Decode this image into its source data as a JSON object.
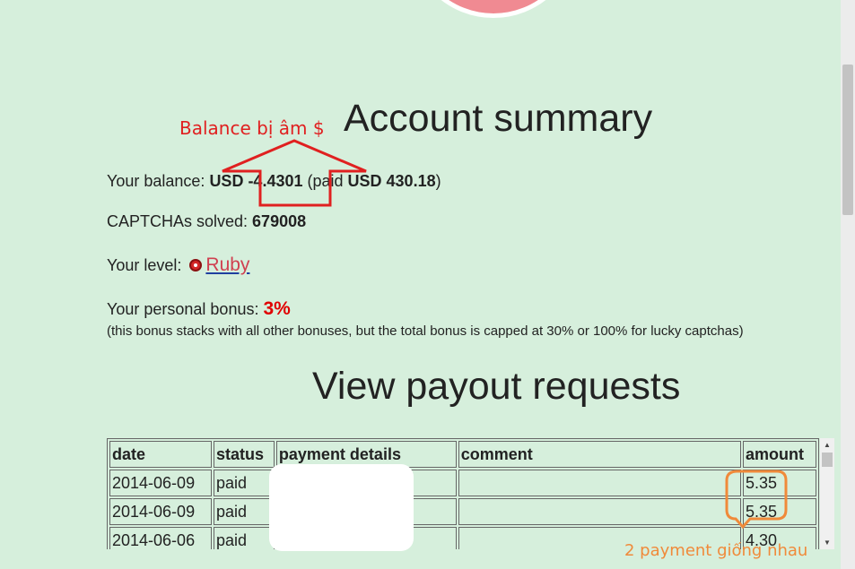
{
  "header": {
    "account_title": "Account summary",
    "payout_title": "View payout requests"
  },
  "summary": {
    "balance_label": "Your balance: ",
    "balance_value": "USD -4.4301",
    "paid_prefix": " (paid ",
    "paid_value": "USD 430.18",
    "paid_suffix": ")",
    "captchas_label": "CAPTCHAs solved: ",
    "captchas_value": "679008",
    "level_label": "Your level: ",
    "level_value": "Ruby",
    "bonus_label": "Your personal bonus: ",
    "bonus_value": "3%",
    "bonus_note": "(this bonus stacks with all other bonuses, but the total bonus is capped at 30% or 100% for lucky captchas)"
  },
  "payouts": {
    "columns": [
      "date",
      "status",
      "payment details",
      "comment",
      "amount"
    ],
    "rows": [
      {
        "date": "2014-06-09",
        "status": "paid",
        "details": "",
        "comment": "",
        "amount": "5.35"
      },
      {
        "date": "2014-06-09",
        "status": "paid",
        "details": "",
        "comment": "",
        "amount": "5.35"
      },
      {
        "date": "2014-06-06",
        "status": "paid",
        "details": "",
        "comment": "",
        "amount": "4.30"
      }
    ]
  },
  "annotations": {
    "balance_note": "Balance bị âm $",
    "payment_note": "2 payment giống nhau"
  },
  "icons": {
    "level_icon": "ruby-gem-icon",
    "scroll_up": "scroll-up-arrow-icon",
    "scroll_down": "scroll-down-arrow-icon"
  },
  "colors": {
    "background": "#d6efdc",
    "bonus": "#e00000",
    "annotation_red": "#e02020",
    "annotation_orange": "#f08a3a",
    "level_link": "#d04050"
  }
}
